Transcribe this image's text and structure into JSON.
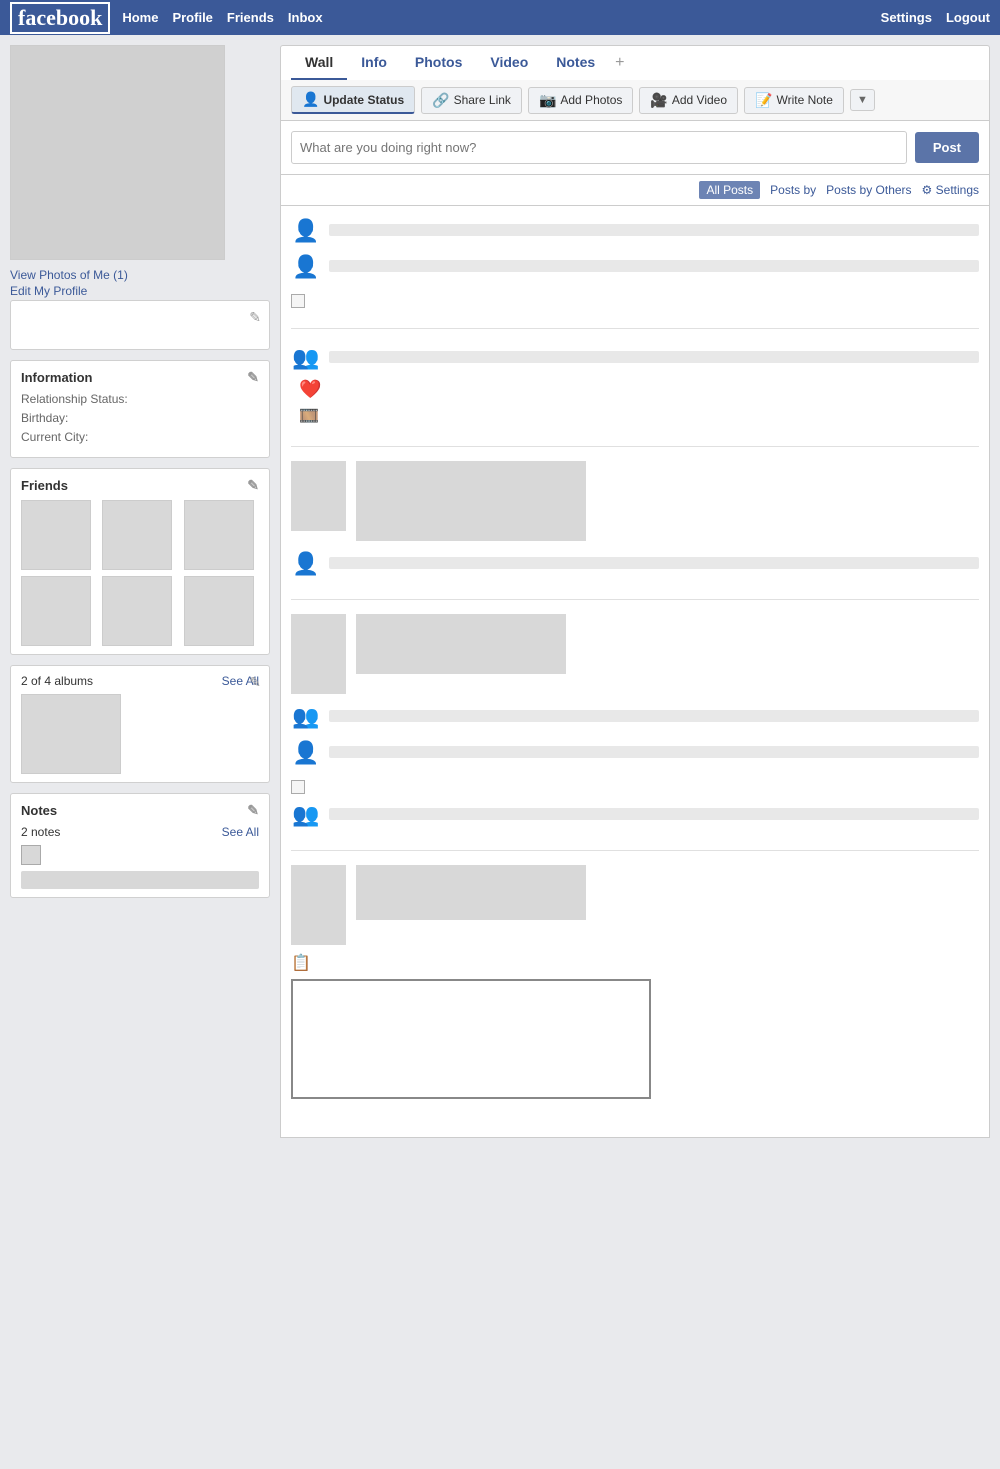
{
  "navbar": {
    "logo": "facebook",
    "links": [
      "Home",
      "Profile",
      "Friends",
      "Inbox"
    ],
    "right_links": [
      "Settings",
      "Logout"
    ]
  },
  "sidebar": {
    "view_photos": "View Photos of Me (1)",
    "edit_profile": "Edit My Profile",
    "information": {
      "title": "Information",
      "relationship_label": "Relationship Status:",
      "birthday_label": "Birthday:",
      "city_label": "Current City:"
    },
    "friends": {
      "title": "Friends"
    },
    "albums": {
      "count_text": "2 of 4 albums",
      "see_all": "See All"
    },
    "notes": {
      "title": "Notes",
      "count_text": "2 notes",
      "see_all": "See All"
    }
  },
  "tabs": {
    "items": [
      "Wall",
      "Info",
      "Photos",
      "Video",
      "Notes"
    ],
    "active": "Wall",
    "plus": "+"
  },
  "actions": {
    "update_status": "Update Status",
    "share_link": "Share Link",
    "add_photos": "Add Photos",
    "add_video": "Add Video",
    "write_note": "Write Note"
  },
  "status_input": {
    "placeholder": "What are you doing right now?",
    "post_button": "Post"
  },
  "filter": {
    "all_posts": "All Posts",
    "posts_by": "Posts by",
    "posts_by_others": "Posts by Others",
    "settings": "⚙ Settings"
  }
}
